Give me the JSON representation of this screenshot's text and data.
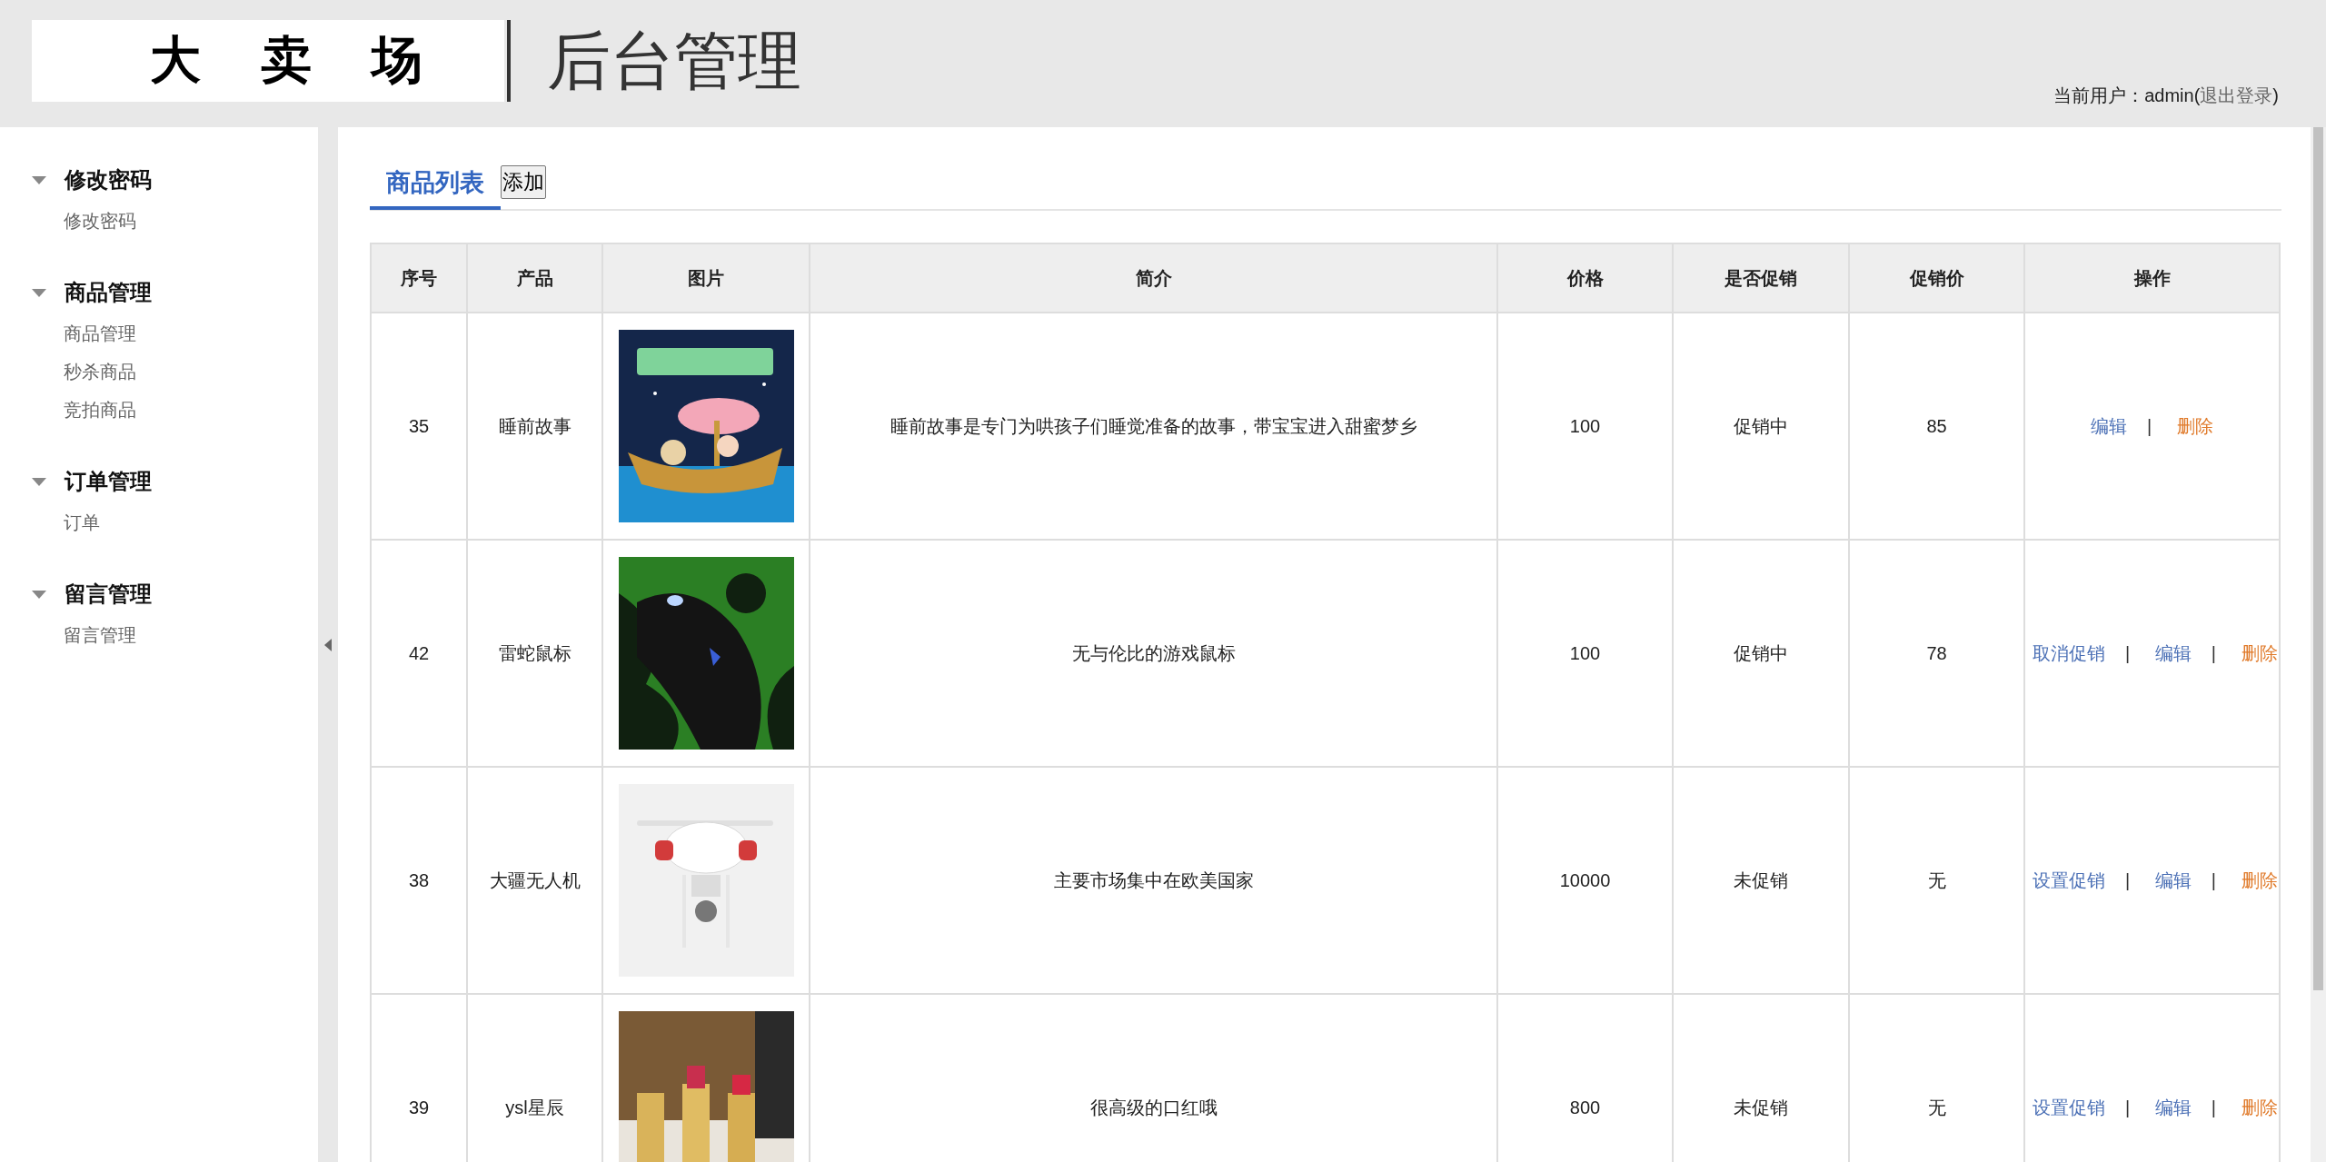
{
  "header": {
    "logo": "大 卖 场",
    "title": "后台管理",
    "user_label": "当前用户：",
    "user_name": "admin",
    "logout_open": "(",
    "logout": "退出登录",
    "logout_close": ")"
  },
  "sidebar": {
    "groups": [
      {
        "title": "修改密码",
        "expanded": true,
        "items": [
          "修改密码"
        ]
      },
      {
        "title": "商品管理",
        "expanded": true,
        "items": [
          "商品管理",
          "秒杀商品",
          "竞拍商品"
        ]
      },
      {
        "title": "订单管理",
        "expanded": true,
        "items": [
          "订单"
        ]
      },
      {
        "title": "留言管理",
        "expanded": true,
        "items": [
          "留言管理"
        ]
      }
    ]
  },
  "tabs": [
    {
      "label": "商品列表",
      "selected": true
    }
  ],
  "add_button": "添加",
  "table": {
    "columns": [
      "序号",
      "产品",
      "图片",
      "简介",
      "价格",
      "是否促销",
      "促销价",
      "操作"
    ],
    "separator": "|",
    "rows": [
      {
        "id": "35",
        "product": "睡前故事",
        "picture": {
          "kind": "picture"
        },
        "intro": "睡前故事是专门为哄孩子们睡觉准备的故事，带宝宝进入甜蜜梦乡",
        "price": "100",
        "promotion": "促销中",
        "promo_price": "85",
        "actions": [
          {
            "kind": "edit",
            "label": "编辑"
          },
          {
            "kind": "delete",
            "label": "删除"
          }
        ]
      },
      {
        "id": "42",
        "product": "雷蛇鼠标",
        "picture": {
          "kind": "picture"
        },
        "intro": "无与伦比的游戏鼠标",
        "price": "100",
        "promotion": "促销中",
        "promo_price": "78",
        "actions": [
          {
            "kind": "promo",
            "label": "取消促销"
          },
          {
            "kind": "edit",
            "label": "编辑"
          },
          {
            "kind": "delete",
            "label": "删除"
          }
        ]
      },
      {
        "id": "38",
        "product": "大疆无人机",
        "picture": {
          "kind": "picture"
        },
        "intro": "主要市场集中在欧美国家",
        "price": "10000",
        "promotion": "未促销",
        "promo_price": "无",
        "actions": [
          {
            "kind": "promo",
            "label": "设置促销"
          },
          {
            "kind": "edit",
            "label": "编辑"
          },
          {
            "kind": "delete",
            "label": "删除"
          }
        ]
      },
      {
        "id": "39",
        "product": "ysl星辰",
        "picture": {
          "kind": "picture"
        },
        "intro": "很高级的口红哦",
        "price": "800",
        "promotion": "未促销",
        "promo_price": "无",
        "actions": [
          {
            "kind": "promo",
            "label": "设置促销"
          },
          {
            "kind": "edit",
            "label": "编辑"
          },
          {
            "kind": "delete",
            "label": "删除"
          }
        ]
      }
    ]
  }
}
